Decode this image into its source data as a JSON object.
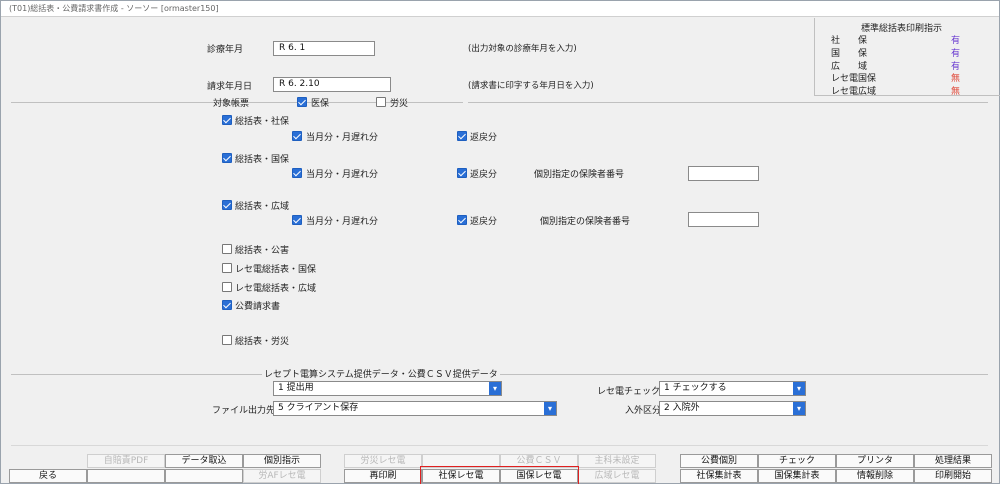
{
  "window": {
    "title": "(T01)総括表・公費請求書作成 - ソーソー [ormaster150]"
  },
  "form": {
    "shinryo_label": "診療年月",
    "shinryo_value": "R 6. 1",
    "shinryo_hint": "(出力対象の診療年月を入力)",
    "seikyu_label": "請求年月日",
    "seikyu_value": "R 6. 2.10",
    "seikyu_hint": "(請求書に印字する年月日を入力)",
    "target_label": "対象帳票",
    "iho_label": "医保",
    "rosai_label": "労災"
  },
  "legend": {
    "title": "標準総括表印刷指示",
    "rows": [
      {
        "label": "社　　保",
        "value": "有"
      },
      {
        "label": "国　　保",
        "value": "有"
      },
      {
        "label": "広　　域",
        "value": "有"
      },
      {
        "label": "レセ電国保",
        "value": "無"
      },
      {
        "label": "レセ電広域",
        "value": "無"
      }
    ]
  },
  "checks": {
    "shaho": "総括表・社保",
    "shaho_current": "当月分・月遅れ分",
    "shaho_return": "返戻分",
    "kokuho": "総括表・国保",
    "kokuho_current": "当月分・月遅れ分",
    "kokuho_return": "返戻分",
    "kokuho_insurer_label": "個別指定の保険者番号",
    "koiki": "総括表・広域",
    "koiki_current": "当月分・月遅れ分",
    "koiki_return": "返戻分",
    "koiki_insurer_label": "個別指定の保険者番号",
    "kogai": "総括表・公害",
    "rece_kokuho": "レセ電総括表・国保",
    "rece_koiki": "レセ電総括表・広域",
    "kohi": "公費請求書",
    "rosai": "総括表・労災"
  },
  "export": {
    "section_label": "レセプト電算システム提供データ・公費ＣＳＶ提供データ",
    "provide_value": "1 提出用",
    "file_dest_label": "ファイル出力先",
    "file_dest_value": "5 クライアント保存",
    "rece_check_label": "レセ電チェック",
    "rece_check_value": "1 チェックする",
    "inout_label": "入外区分",
    "inout_value": "2 入院外"
  },
  "buttons": {
    "back": "戻る",
    "jibai_pdf": "自賠責PDF",
    "data_import": "データ取込",
    "individual": "個別指示",
    "rosai_rece": "労災レセ電",
    "reprint": "再印刷",
    "af_rece": "労AFレセ電",
    "shaho_rece": "社保レセ電",
    "kohi_csv": "公費ＣＳＶ",
    "kokuho_rece": "国保レセ電",
    "main_unset": "主科未設定",
    "koiki_rece": "広域レセ電",
    "kohi_individual": "公費個別",
    "check": "チェック",
    "printer": "プリンタ",
    "result": "処理結果",
    "shaho_summary": "社保集計表",
    "kokuho_summary": "国保集計表",
    "delete_info": "情報削除",
    "print_start": "印刷開始"
  }
}
